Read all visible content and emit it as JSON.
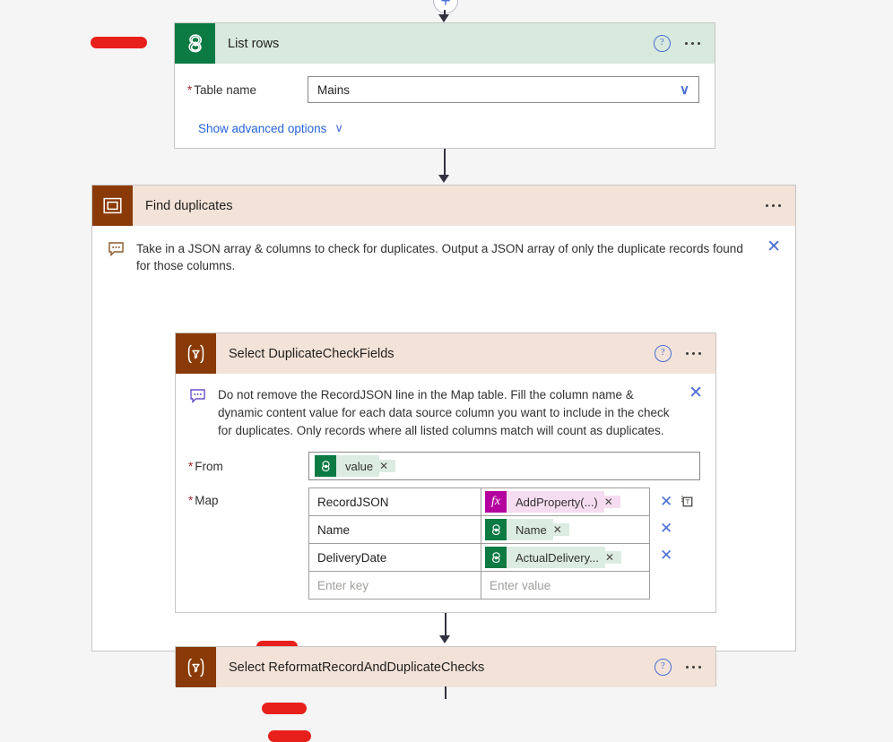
{
  "canvas": {
    "background": "#f5f5f5",
    "insert_button_label": "+"
  },
  "list_rows_card": {
    "icon": "dataverse-icon",
    "title": "List rows",
    "help_icon": "?",
    "more_icon": "ellipsis-icon",
    "fields": [
      {
        "required_marker": "*",
        "label": "Table name",
        "value": "Mains",
        "chevron": "∨"
      }
    ],
    "advanced_link": "Show advanced options",
    "advanced_chevron": "∨"
  },
  "scope_card": {
    "icon": "scope-icon",
    "title": "Find duplicates",
    "more_icon": "ellipsis-icon",
    "comment": {
      "icon": "comment-icon",
      "text": "Take in a JSON array & columns to check for duplicates. Output a JSON array of only the duplicate records found for those columns.",
      "close": "✕"
    }
  },
  "select_duplicate_check_fields": {
    "icon": "data-operation-select-icon",
    "title": "Select DuplicateCheckFields",
    "help_icon": "?",
    "more_icon": "ellipsis-icon",
    "comment": {
      "icon": "comment-icon",
      "text": "Do not remove the RecordJSON line in the Map table. Fill the column name & dynamic content value for each data source column you want to include in the check for duplicates. Only records where all listed columns match will count as duplicates.",
      "close": "✕"
    },
    "from": {
      "required_marker": "*",
      "label": "From",
      "token": {
        "kind": "green",
        "icon": "dataverse-icon",
        "label": "value",
        "remove": "✕"
      }
    },
    "map": {
      "required_marker": "*",
      "label": "Map",
      "key_placeholder": "Enter key",
      "value_placeholder": "Enter value",
      "rows": [
        {
          "key": "RecordJSON",
          "token": {
            "kind": "magenta",
            "icon": "function-fx-icon",
            "label": "AddProperty(...)",
            "remove": "✕"
          },
          "delete": "✕",
          "text_mode": "switch-to-text-mode-icon"
        },
        {
          "key": "Name",
          "token": {
            "kind": "green",
            "icon": "dataverse-icon",
            "label": "Name",
            "remove": "✕"
          },
          "delete": "✕"
        },
        {
          "key": "DeliveryDate",
          "token": {
            "kind": "green",
            "icon": "dataverse-icon",
            "label": "ActualDelivery...",
            "remove": "✕"
          },
          "delete": "✕"
        }
      ]
    }
  },
  "select_reformat_card": {
    "icon": "data-operation-select-icon",
    "title": "Select ReformatRecordAndDuplicateChecks",
    "help_icon": "?",
    "more_icon": "ellipsis-icon"
  },
  "redactions": {
    "count": 4,
    "color": "#e8201c",
    "note": "red redaction bars hiding labels"
  },
  "colors": {
    "dataverse_green": "#0b7a43",
    "dataverse_green_light": "#d8e9dd",
    "scope_brown": "#8a3a06",
    "scope_brown_light": "#f2e2d8",
    "select_purple": "#8661f0",
    "select_purple_light": "#e9e4fb",
    "function_magenta": "#b4009e",
    "link_blue": "#2663d9"
  }
}
